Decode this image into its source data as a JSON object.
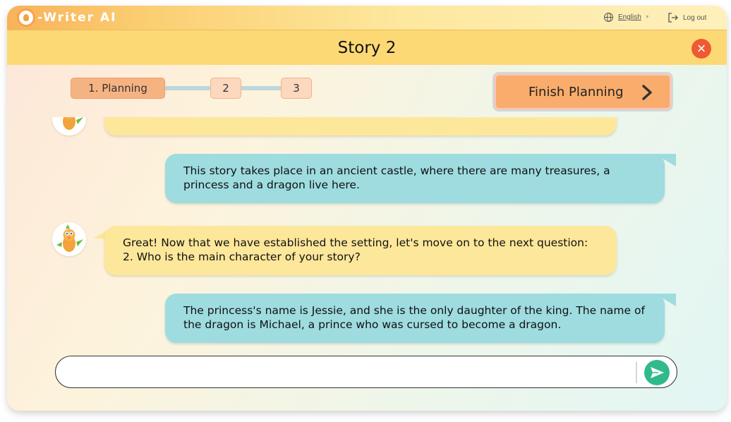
{
  "app": {
    "logo_text": "-Writer AI"
  },
  "header": {
    "language_label": "English",
    "logout_label": "Log out"
  },
  "story": {
    "title": "Story 2"
  },
  "steps": [
    {
      "label": "1. Planning"
    },
    {
      "label": "2"
    },
    {
      "label": "3"
    }
  ],
  "finish_button": {
    "label": "Finish Planning"
  },
  "messages": [
    {
      "sender": "ai",
      "line1": "",
      "line2": ""
    },
    {
      "sender": "user",
      "line1": "This story takes place in an ancient castle, where there are many treasures, a",
      "line2": "princess and a dragon live here."
    },
    {
      "sender": "ai",
      "line1": "Great! Now that we have established the setting, let's move on to the next question:",
      "line2": "2. Who is the main character of your story?"
    },
    {
      "sender": "user",
      "line1": "The princess's name is Jessie, and she is the only daughter of the king. The name of",
      "line2": "the dragon is Michael, a prince who was cursed to become a dragon."
    }
  ],
  "composer": {
    "value": "",
    "placeholder": ""
  },
  "colors": {
    "accent_orange": "#f9ac6c",
    "ai_bubble": "#fde79a",
    "user_bubble": "#9edce0",
    "send_green": "#30ba8c",
    "close_red": "#ef5a33"
  },
  "icons": {
    "language": "globe-icon",
    "logout": "logout-icon",
    "close": "close-icon",
    "finish": "chevron-right-icon",
    "send": "send-icon",
    "avatar": "parrot-avatar-icon"
  }
}
